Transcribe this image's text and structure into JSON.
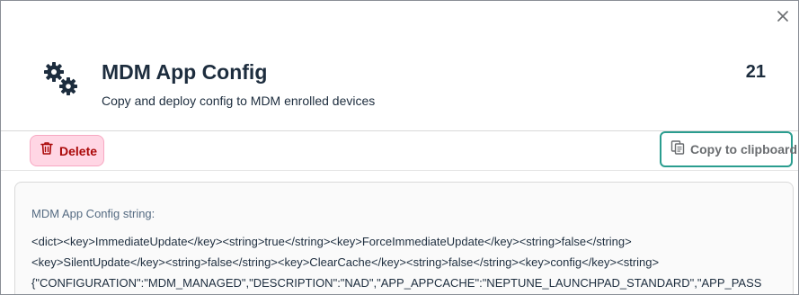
{
  "dialog": {
    "title": "MDM App Config",
    "subtitle": "Copy and deploy config to MDM enrolled devices",
    "counter": "21",
    "icons": {
      "header": "gears-icon",
      "close": "close-icon"
    }
  },
  "toolbar": {
    "delete_label": "Delete",
    "copy_label": "Copy to clipboard",
    "icons": {
      "delete": "trash-icon",
      "copy": "copy-icon"
    }
  },
  "content": {
    "label": "MDM App Config string:",
    "lines": [
      "<dict><key>ImmediateUpdate</key><string>true</string><key>ForceImmediateUpdate</key><string>false</string>",
      "<key>SilentUpdate</key><string>false</string><key>ClearCache</key><string>false</string><key>config</key><string>",
      "{\"CONFIGURATION\":\"MDM_MANAGED\",\"DESCRIPTION\":\"NAD\",\"APP_APPCACHE\":\"NEPTUNE_LAUNCHPAD_STANDARD\",\"APP_PASS"
    ]
  },
  "colors": {
    "delete_bg": "#ffd6e4",
    "delete_text": "#aa0808",
    "copy_focus_border": "#2a9d8f",
    "text": "#1d2d3e"
  }
}
